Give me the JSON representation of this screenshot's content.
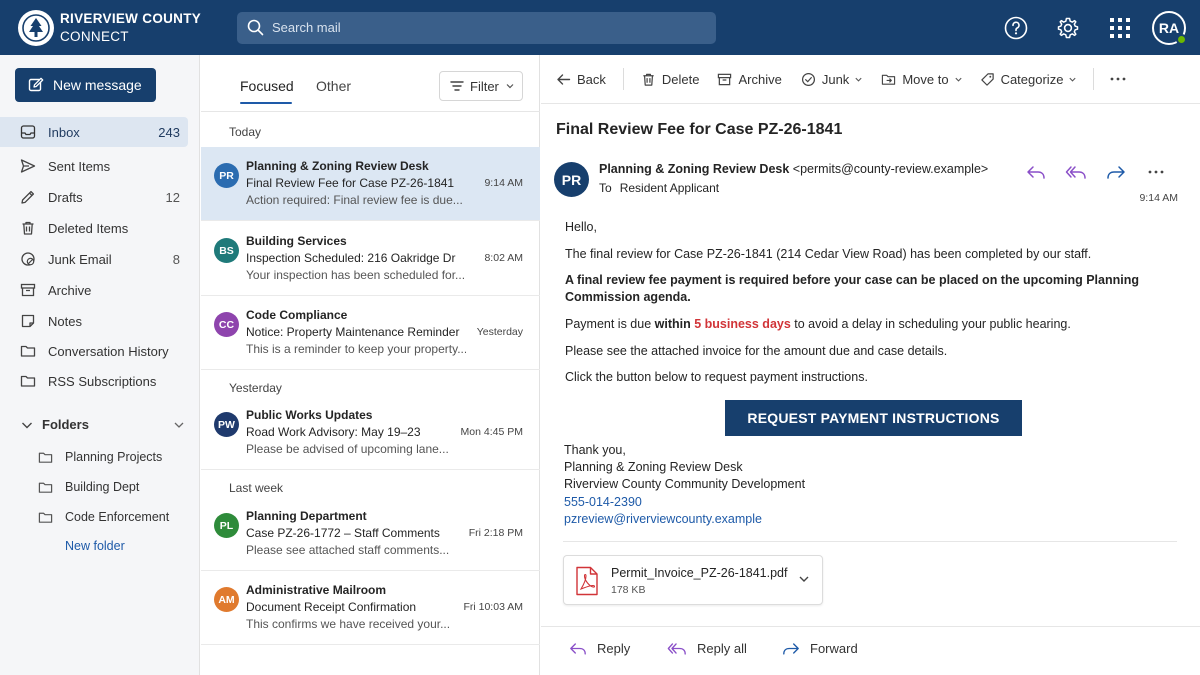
{
  "header": {
    "brand_line1": "RIVERVIEW COUNTY",
    "brand_line2": "CONNECT",
    "search_placeholder": "Search mail",
    "avatar_initials": "RA",
    "colors": {
      "topbar": "#173f6d",
      "accent": "#1e5aa8",
      "presence": "#6bb700"
    }
  },
  "sidebar": {
    "new_message": "New message",
    "items": [
      {
        "label": "Inbox",
        "count": "243",
        "icon": "inbox-icon"
      },
      {
        "label": "Sent Items",
        "count": "",
        "icon": "send-icon"
      },
      {
        "label": "Drafts",
        "count": "12",
        "icon": "pencil-icon"
      },
      {
        "label": "Deleted Items",
        "count": "",
        "icon": "trash-icon"
      },
      {
        "label": "Junk Email",
        "count": "8",
        "icon": "block-icon"
      },
      {
        "label": "Archive",
        "count": "",
        "icon": "archive-icon"
      },
      {
        "label": "Notes",
        "count": "",
        "icon": "note-icon"
      },
      {
        "label": "Conversation History",
        "count": "",
        "icon": "folder-icon"
      },
      {
        "label": "RSS Subscriptions",
        "count": "",
        "icon": "folder-icon"
      }
    ],
    "folders_label": "Folders",
    "folders": [
      "Planning Projects",
      "Building Dept",
      "Code Enforcement"
    ],
    "new_folder": "New folder"
  },
  "message_list": {
    "tabs": [
      "Focused",
      "Other"
    ],
    "filter_label": "Filter",
    "groups": [
      "Today",
      "Yesterday",
      "Last week"
    ],
    "messages": [
      {
        "initials": "PR",
        "color": "#2b6cb0",
        "sender": "Planning & Zoning Review Desk",
        "subject": "Final Review Fee for Case PZ-26-1841",
        "time": "9:14 AM",
        "preview": "Action required: Final review fee is due..."
      },
      {
        "initials": "BS",
        "color": "#1f7a7a",
        "sender": "Building Services",
        "subject": "Inspection Scheduled: 216 Oakridge Dr",
        "time": "8:02 AM",
        "preview": "Your inspection has been scheduled for..."
      },
      {
        "initials": "CC",
        "color": "#8e44ad",
        "sender": "Code Compliance",
        "subject": "Notice: Property Maintenance Reminder",
        "time": "Yesterday",
        "preview": "This is a reminder to keep your property..."
      },
      {
        "initials": "PW",
        "color": "#1f3a6d",
        "sender": "Public Works Updates",
        "subject": "Road Work Advisory: May 19–23",
        "time": "Mon 4:45 PM",
        "preview": "Please be advised of upcoming lane..."
      },
      {
        "initials": "PL",
        "color": "#2e8b3a",
        "sender": "Planning Department",
        "subject": "Case PZ-26-1772 – Staff Comments",
        "time": "Fri 2:18 PM",
        "preview": "Please see attached staff comments..."
      },
      {
        "initials": "AM",
        "color": "#e07a2e",
        "sender": "Administrative Mailroom",
        "subject": "Document Receipt Confirmation",
        "time": "Fri 10:03 AM",
        "preview": "This confirms we have received your..."
      }
    ]
  },
  "reading": {
    "toolbar": {
      "back": "Back",
      "delete": "Delete",
      "archive": "Archive",
      "junk": "Junk",
      "move_to": "Move to",
      "categorize": "Categorize"
    },
    "subject": "Final Review Fee for Case PZ-26-1841",
    "from_initials": "PR",
    "from_name": "Planning & Zoning Review Desk",
    "from_email": "<permits@county-review.example>",
    "to_label": "To",
    "to_name": "Resident Applicant",
    "time": "9:14 AM",
    "body": {
      "greeting": "Hello,",
      "p1": "The final review for Case PZ-26-1841 (214 Cedar View Road) has been completed by our staff.",
      "p2": "A final review fee payment is required before your case can be placed on the upcoming Planning Commission agenda.",
      "p3_a": "Payment is due ",
      "p3_b": "within ",
      "p3_c": "5 business days",
      "p3_d": " to avoid a delay in scheduling your public hearing.",
      "p4": "Please see the attached invoice for the amount due and case details.",
      "p5": "Click the button below to request payment instructions.",
      "cta": "REQUEST PAYMENT INSTRUCTIONS",
      "sig1": "Thank you,",
      "sig2": "Planning & Zoning Review Desk",
      "sig3": "Riverview County Community Development",
      "phone": "555-014-2390",
      "email": "pzreview@riverviewcounty.example"
    },
    "attachment": {
      "name": "Permit_Invoice_PZ-26-1841.pdf",
      "size": "178 KB"
    },
    "footer": {
      "reply": "Reply",
      "reply_all": "Reply all",
      "forward": "Forward"
    }
  }
}
